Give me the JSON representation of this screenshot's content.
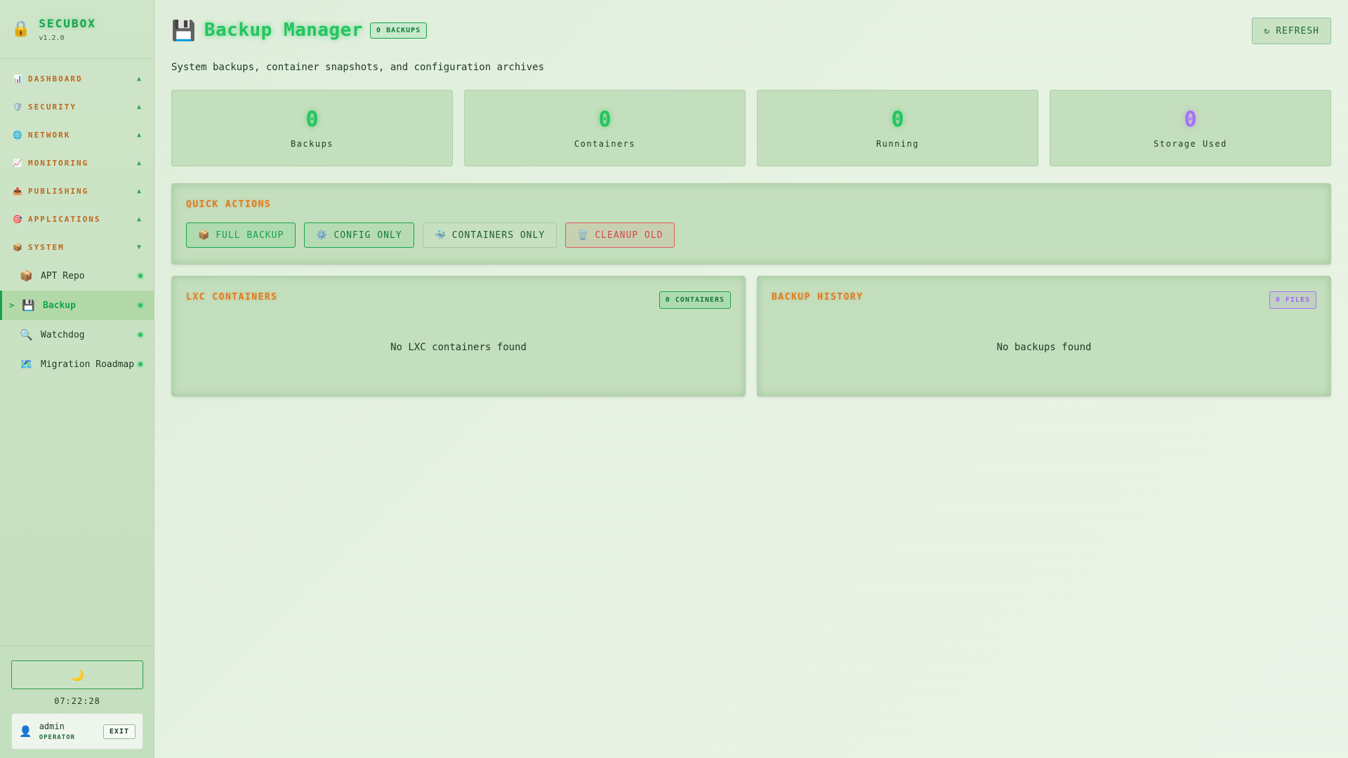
{
  "brand": {
    "icon": "lock-icon",
    "name": "SECUBOX",
    "version": "v1.2.0"
  },
  "nav": {
    "sections": [
      {
        "icon": "📊",
        "label": "DASHBOARD",
        "chevron": "▲"
      },
      {
        "icon": "🛡️",
        "label": "SECURITY",
        "chevron": "▲"
      },
      {
        "icon": "🌐",
        "label": "NETWORK",
        "chevron": "▲"
      },
      {
        "icon": "📈",
        "label": "MONITORING",
        "chevron": "▲"
      },
      {
        "icon": "📤",
        "label": "PUBLISHING",
        "chevron": "▲"
      },
      {
        "icon": "🎯",
        "label": "APPLICATIONS",
        "chevron": "▲"
      },
      {
        "icon": "📦",
        "label": "SYSTEM",
        "chevron": "▼"
      }
    ],
    "system_items": [
      {
        "icon": "📦",
        "label": "APT Repo"
      },
      {
        "icon": "💾",
        "label": "Backup",
        "active_marker": ">"
      },
      {
        "icon": "🔍",
        "label": "Watchdog"
      },
      {
        "icon": "🗺️",
        "label": "Migration Roadmap"
      }
    ]
  },
  "sidebar_bottom": {
    "theme_icon": "🌙",
    "clock": "07:22:28",
    "user": {
      "icon": "👤",
      "name": "admin",
      "role": "OPERATOR",
      "exit_label": "EXIT"
    }
  },
  "header": {
    "icon": "💾",
    "title": "Backup Manager",
    "badge": "0 BACKUPS",
    "refresh_icon": "↻",
    "refresh_label": "REFRESH",
    "subtitle": "System backups, container snapshots, and configuration archives"
  },
  "stats": [
    {
      "value": "0",
      "label": "Backups"
    },
    {
      "value": "0",
      "label": "Containers"
    },
    {
      "value": "0",
      "label": "Running"
    },
    {
      "value": "0",
      "label": "Storage Used"
    }
  ],
  "quick_actions": {
    "title": "QUICK ACTIONS",
    "buttons": [
      {
        "icon": "📦",
        "label": "FULL BACKUP"
      },
      {
        "icon": "⚙️",
        "label": "CONFIG ONLY"
      },
      {
        "icon": "🐳",
        "label": "CONTAINERS ONLY"
      },
      {
        "icon": "🗑️",
        "label": "CLEANUP OLD"
      }
    ]
  },
  "lxc": {
    "title": "LXC CONTAINERS",
    "badge": "0 CONTAINERS",
    "empty": "No LXC containers found"
  },
  "history": {
    "title": "BACKUP HISTORY",
    "badge": "0 FILES",
    "empty": "No backups found"
  },
  "colors": {
    "accent": "#22c55e",
    "orange": "#e07a1f",
    "purple": "#a572f0",
    "danger": "#e05b5b"
  }
}
